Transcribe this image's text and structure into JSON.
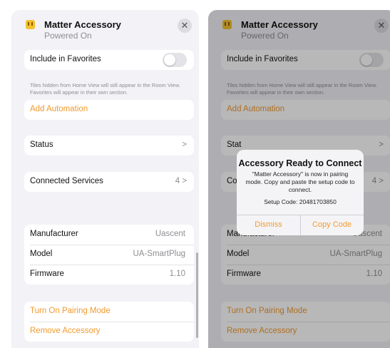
{
  "screens": [
    {
      "header": {
        "title": "Matter Accessory",
        "subtitle": "Powered On",
        "close": "✕"
      },
      "favorites": {
        "label": "Include in Favorites",
        "toggle_on": false,
        "footnote": "Tiles hidden from Home View will still appear in the Room View. Favorites will appear in their own section."
      },
      "add_automation": "Add Automation",
      "status": {
        "label": "Status",
        "chevron": ">"
      },
      "connected_services": {
        "label": "Connected Services",
        "value": "4 >"
      },
      "info": {
        "manufacturer": {
          "label": "Manufacturer",
          "value": "Uascent"
        },
        "model": {
          "label": "Model",
          "value": "UA-SmartPlug"
        },
        "firmware": {
          "label": "Firmware",
          "value": "1.10"
        }
      },
      "pairing": "Turn On Pairing Mode",
      "remove": "Remove Accessory"
    },
    {
      "header": {
        "title": "Matter Accessory",
        "subtitle": "Powered On",
        "close": "✕"
      },
      "favorites": {
        "label": "Include in Favorites",
        "toggle_on": false,
        "footnote": "Tiles hidden from Home View will still appear in the Room View. Favorites will appear in their own section."
      },
      "add_automation": "Add Automation",
      "status": {
        "label": "Stat",
        "chevron": ">"
      },
      "connected_services": {
        "label": "Cor",
        "value": "4 >"
      },
      "info": {
        "manufacturer": {
          "label": "Manufacturer",
          "value": "Uascent"
        },
        "model": {
          "label": "Model",
          "value": "UA-SmartPlug"
        },
        "firmware": {
          "label": "Firmware",
          "value": "1.10"
        }
      },
      "pairing": "Turn On Pairing Mode",
      "remove": "Remove Accessory"
    }
  ],
  "alert": {
    "title": "Accessory Ready to Connect",
    "message": "\"Matter Accessory\" is now in pairing mode. Copy and paste the setup code to connect.",
    "setup_code": "Setup Code: 20481703850",
    "dismiss": "Dismiss",
    "copy_code": "Copy Code"
  },
  "colors": {
    "accent": "#f29a2e",
    "background": "#f2f2f7",
    "icon": "#f2c12e"
  }
}
